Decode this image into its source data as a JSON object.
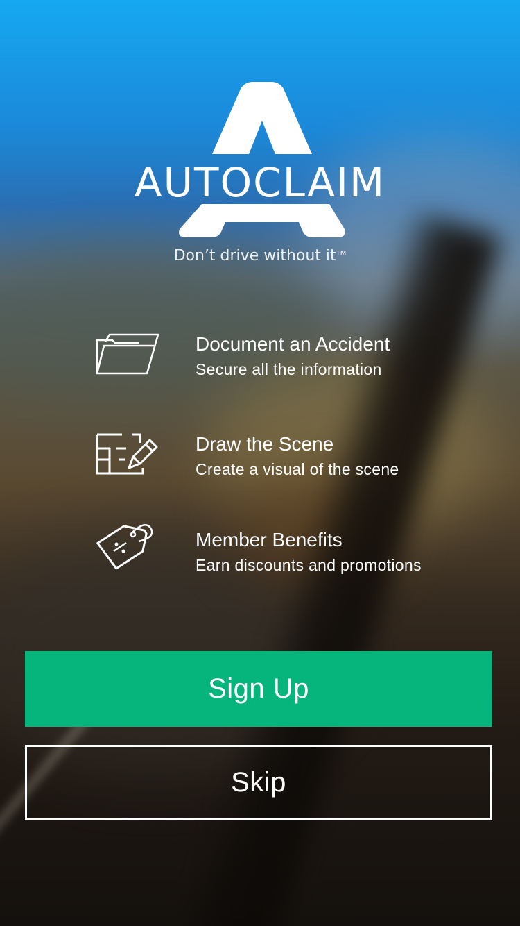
{
  "app": {
    "name": "AUTOCLAIM",
    "tagline": "Don’t drive without it",
    "trademark": "TM"
  },
  "features": [
    {
      "icon": "folder-icon",
      "title": "Document an Accident",
      "subtitle": "Secure all the information"
    },
    {
      "icon": "draw-scene-icon",
      "title": "Draw the Scene",
      "subtitle": "Create a visual of the scene"
    },
    {
      "icon": "discount-tag-icon",
      "title": "Member Benefits",
      "subtitle": "Earn discounts and promotions"
    }
  ],
  "actions": {
    "signup_label": "Sign Up",
    "skip_label": "Skip"
  },
  "colors": {
    "primary_button": "#06b57b",
    "text": "#ffffff",
    "sky_top": "#16a8f2"
  }
}
